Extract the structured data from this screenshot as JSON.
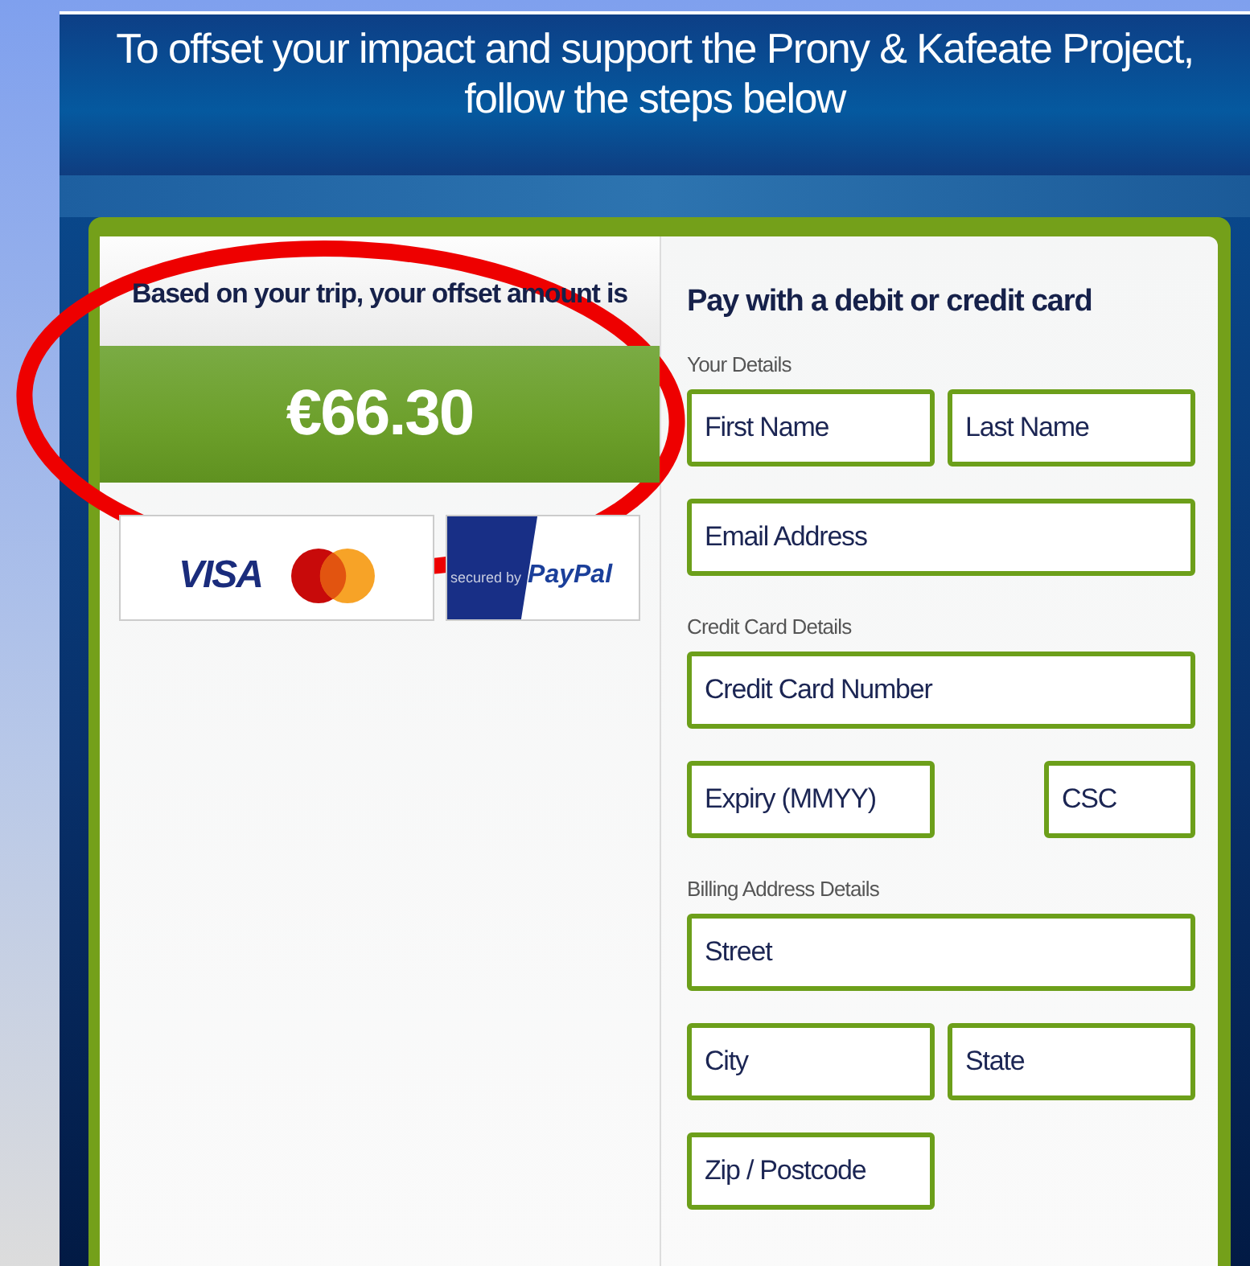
{
  "header": {
    "title": "To offset your impact and support the Prony & Kafeate Project, follow the steps below"
  },
  "summary": {
    "label": "Based on your trip, your offset amount is",
    "amount": "€66.30",
    "logos": [
      {
        "kind": "cards",
        "texts": [
          "VISA"
        ]
      },
      {
        "kind": "paypal",
        "texts": [
          "secured by",
          "PayPal"
        ]
      }
    ]
  },
  "annotation": {
    "kind": "ellipse"
  },
  "payment": {
    "title": "Pay with a debit or credit card",
    "sections": [
      {
        "label": "Your Details",
        "rows": [
          [
            {
              "placeholder": "First Name",
              "kind": "half"
            },
            {
              "placeholder": "Last Name",
              "kind": "half"
            }
          ],
          [
            {
              "placeholder": "Email Address",
              "kind": "full"
            }
          ]
        ]
      },
      {
        "label": "Credit Card Details",
        "rows": [
          [
            {
              "placeholder": "Credit Card Number",
              "kind": "full"
            }
          ],
          [
            {
              "placeholder": "Expiry (MMYY)",
              "kind": "half"
            },
            {
              "placeholder": "CSC",
              "kind": "small"
            }
          ]
        ]
      },
      {
        "label": "Billing Address Details",
        "rows": [
          [
            {
              "placeholder": "Street",
              "kind": "full"
            }
          ],
          [
            {
              "placeholder": "City",
              "kind": "half"
            },
            {
              "placeholder": "State",
              "kind": "half"
            }
          ],
          [
            {
              "placeholder": "Zip / Postcode",
              "kind": "half"
            }
          ]
        ]
      }
    ]
  }
}
